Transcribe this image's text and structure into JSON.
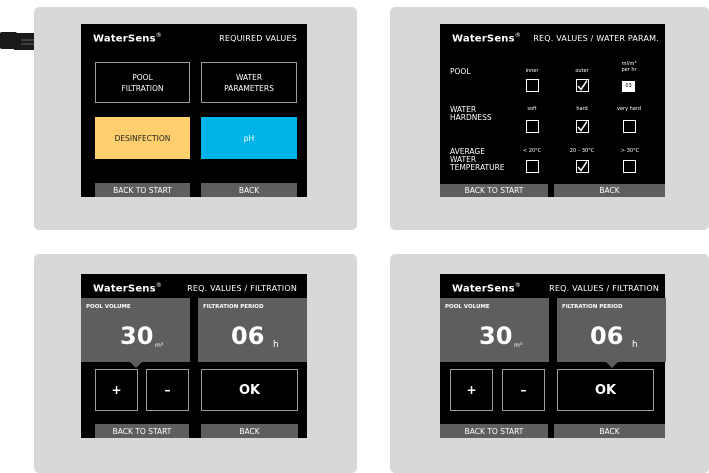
{
  "hand": {
    "icon": "pointing-hand-icon"
  },
  "brand": {
    "name": "WaterSens",
    "mark": "®"
  },
  "screen1": {
    "title": "REQUIRED VALUES",
    "pool_filtration": "POOL FILTRATION",
    "water_parameters": "WATER PARAMETERS",
    "desinfection": "DESINFECTION",
    "ph": "pH",
    "back_to_start": "BACK TO START",
    "back": "BACK",
    "colors": {
      "desinfection": "#ffcf6e",
      "ph": "#00b3e8"
    }
  },
  "screen2": {
    "title": "REQ. VALUES / WATER PARAM.",
    "pool_label": "POOL",
    "hardness_label": "WATER HARDNESS",
    "temp_label": "AVERAGE WATER TEMPERATURE",
    "pool_options": [
      "inner",
      "outer",
      "ml/m³ per hr"
    ],
    "pool_dosing_value": "03",
    "hardness_options": [
      "soft",
      "hard",
      "very hard"
    ],
    "temp_options": [
      "< 20°C",
      "20 – 30°C",
      "> 30°C"
    ],
    "pool_checked": [
      false,
      true
    ],
    "hardness_checked": [
      false,
      true,
      false
    ],
    "temp_checked": [
      false,
      true,
      false
    ],
    "back_to_start": "BACK TO START",
    "back": "BACK"
  },
  "screen3": {
    "title": "REQ. VALUES / FILTRATION",
    "pool_volume_label": "POOL VOLUME",
    "pool_volume_value": "30",
    "pool_volume_unit": "m³",
    "filtration_period_label": "FILTRATION PERIOD",
    "filtration_period_value": "06",
    "filtration_period_unit": "h",
    "plus": "+",
    "minus": "–",
    "ok": "OK",
    "back_to_start": "BACK TO START",
    "back": "BACK"
  },
  "screen4": {
    "title": "REQ. VALUES / FILTRATION",
    "pool_volume_label": "POOL VOLUME",
    "pool_volume_value": "30",
    "pool_volume_unit": "m³",
    "filtration_period_label": "FILTRATION PERIOD",
    "filtration_period_value": "06",
    "filtration_period_unit": "h",
    "plus": "+",
    "minus": "–",
    "ok": "OK",
    "back_to_start": "BACK TO START",
    "back": "BACK"
  }
}
